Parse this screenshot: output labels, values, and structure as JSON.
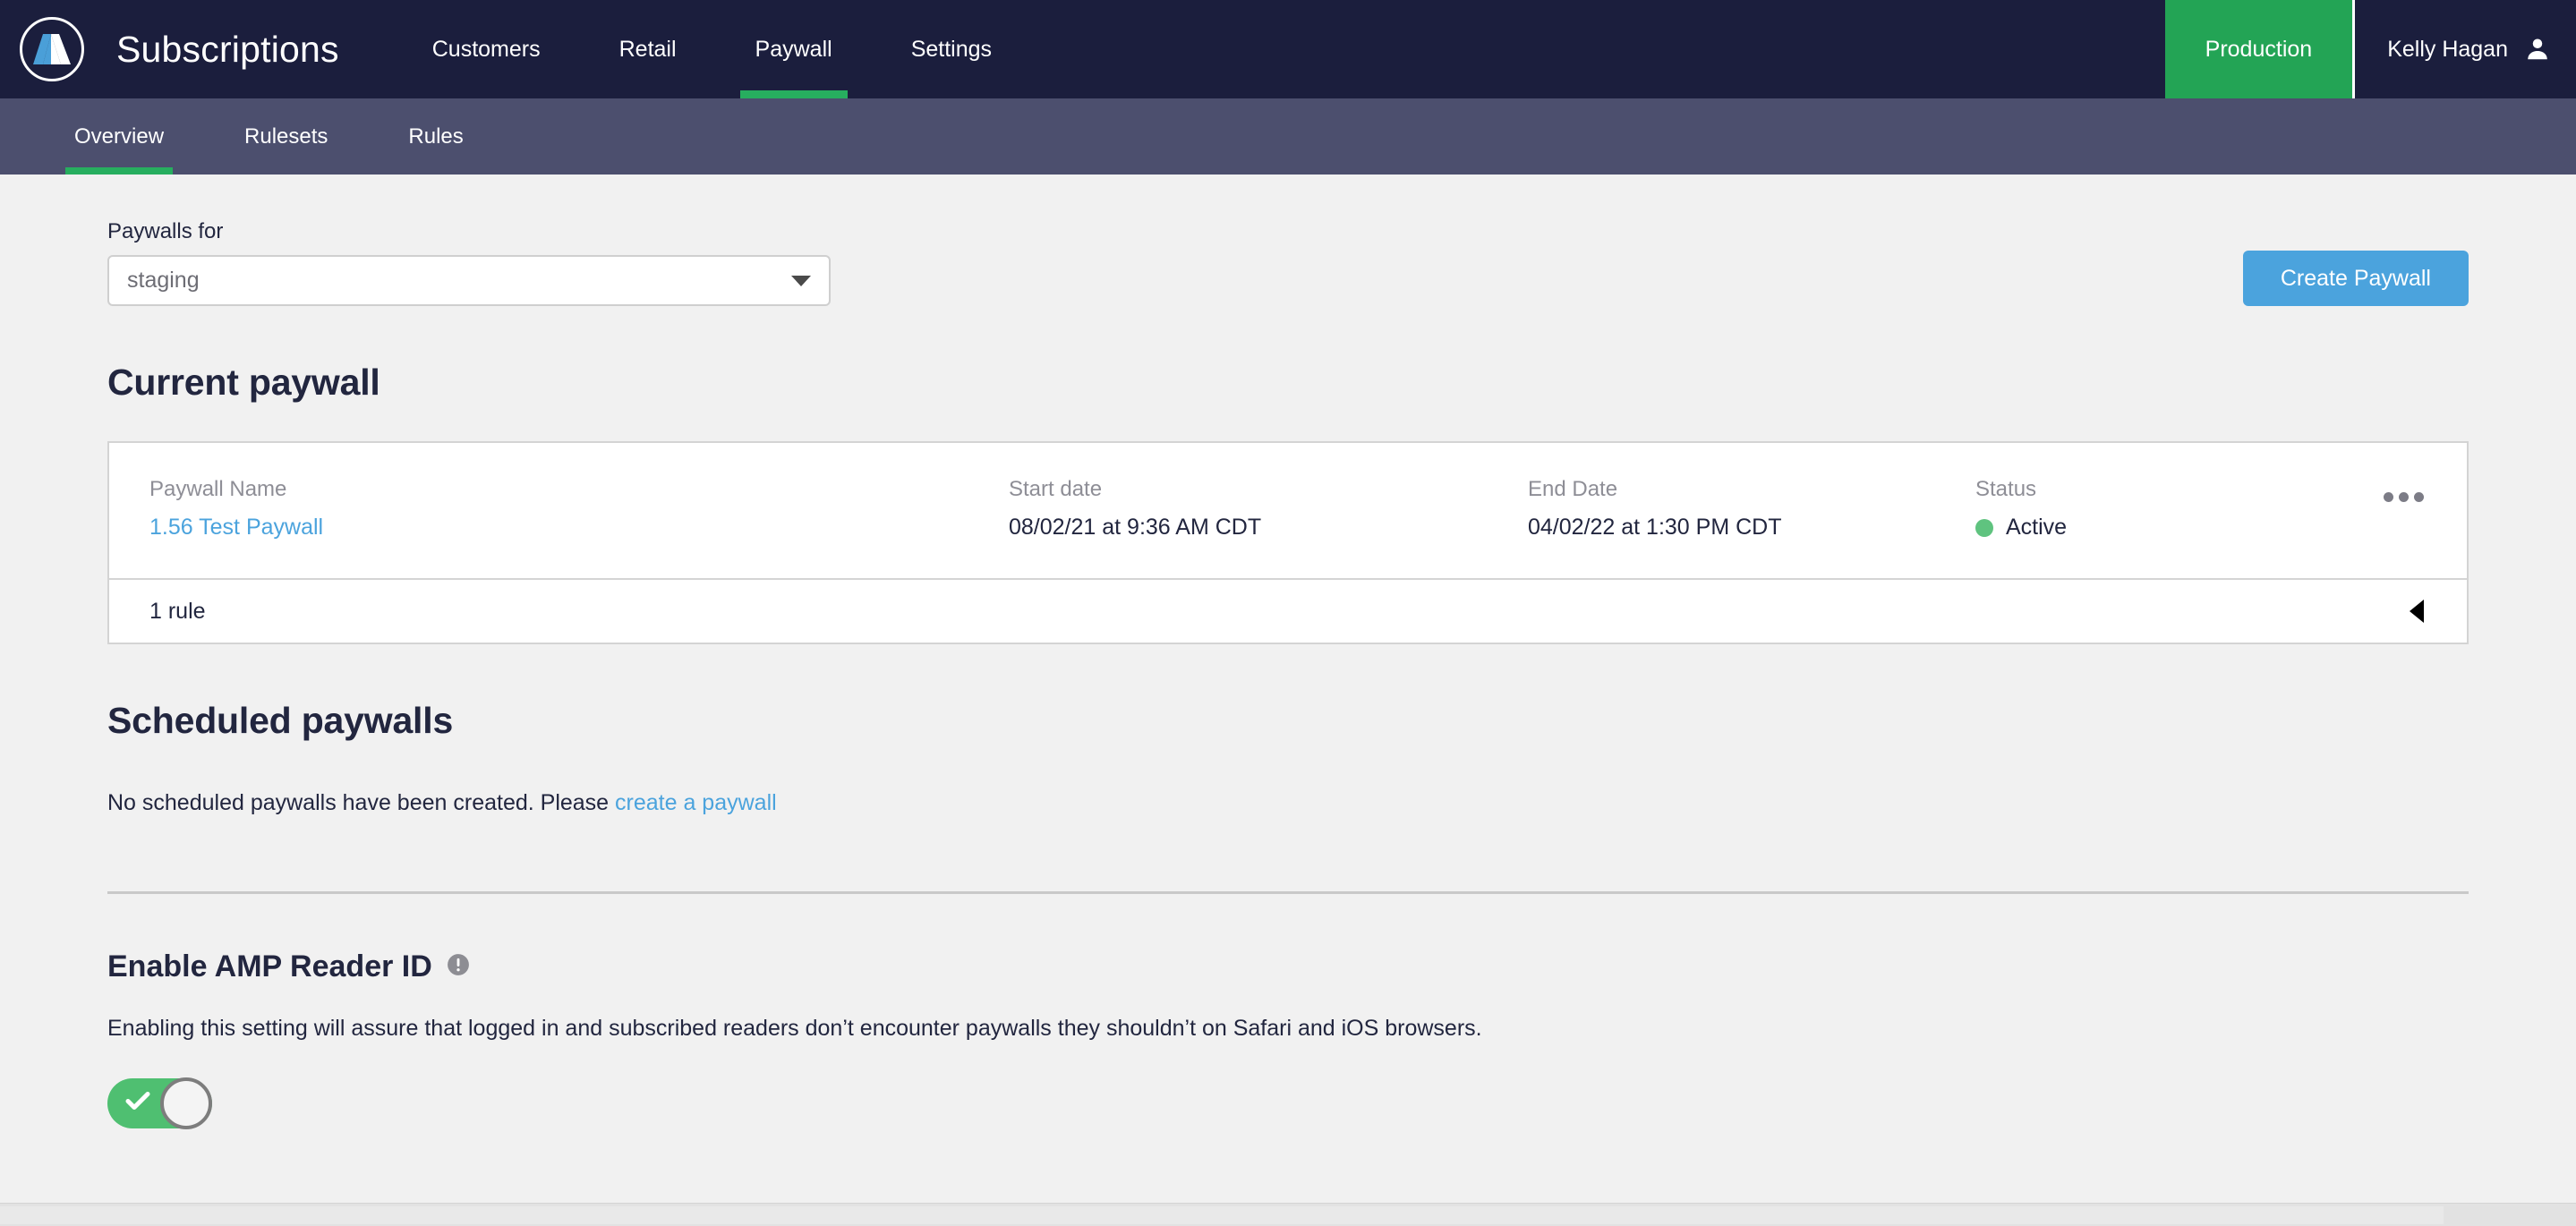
{
  "header": {
    "logo_name": "arc-logo",
    "brand": "Subscriptions",
    "nav": [
      {
        "label": "Customers",
        "active": false
      },
      {
        "label": "Retail",
        "active": false
      },
      {
        "label": "Paywall",
        "active": true
      },
      {
        "label": "Settings",
        "active": false
      }
    ],
    "environment": "Production",
    "user_name": "Kelly Hagan",
    "accent_green": "#27ae5f",
    "bar_color": "#1b1e3d"
  },
  "subnav": {
    "items": [
      {
        "label": "Overview",
        "active": true
      },
      {
        "label": "Rulesets",
        "active": false
      },
      {
        "label": "Rules",
        "active": false
      }
    ],
    "bar_color": "#4c4f6e"
  },
  "filter": {
    "label": "Paywalls for",
    "selected": "staging",
    "placeholder": "staging"
  },
  "actions": {
    "create_paywall": "Create Paywall",
    "primary_color": "#4ba3dd"
  },
  "current_paywall": {
    "title": "Current paywall",
    "columns": {
      "name": "Paywall Name",
      "start_date": "Start date",
      "end_date": "End Date",
      "status": "Status"
    },
    "row": {
      "name": "1.56 Test Paywall",
      "start_date": "08/02/21 at 9:36 AM CDT",
      "end_date": "04/02/22 at 1:30 PM CDT",
      "status": "Active",
      "status_color": "#5fc37f"
    },
    "rule_count": "1 rule"
  },
  "scheduled": {
    "title": "Scheduled paywalls",
    "empty_prefix": "No scheduled paywalls have been created. Please ",
    "empty_link": "create a paywall"
  },
  "amp": {
    "title": "Enable AMP Reader ID",
    "description": "Enabling this setting will assure that logged in and subscribed readers don’t encounter paywalls they shouldn’t on Safari and iOS browsers.",
    "toggle_on": true,
    "toggle_color": "#4fbf71"
  }
}
